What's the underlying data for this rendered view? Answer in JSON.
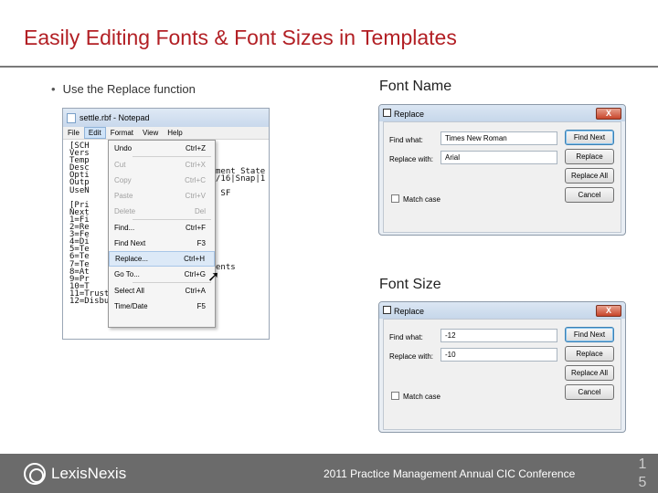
{
  "slide": {
    "title": "Easily Editing Fonts & Font Sizes in Templates",
    "bullet": "Use the Replace function",
    "label_font_name": "Font Name",
    "label_font_size": "Font Size"
  },
  "notepad": {
    "window_title": "settle.rbf - Notepad",
    "menubar": [
      "File",
      "Edit",
      "Format",
      "View",
      "Help"
    ],
    "active_menu": "Edit",
    "text_left": "[SCH\nVers\nTemp\nDesc\nOpti\nOutp\nUseN\n\n[Pri\nNext\n1=Fi\n2=Re\n3=Fe\n4=Di\n5=Te\n6=Te\n7=Te\n8=At\n9=Pr\n10=T\n11=Trust Deductions\n12=Disbursements",
    "text_right": "ment State\n/16|Snap|1\n\n SF\n\n\n\n\n\n\n\n\n\nents",
    "edit_menu": [
      {
        "label": "Undo",
        "shortcut": "Ctrl+Z",
        "disabled": false
      },
      {
        "sep": true
      },
      {
        "label": "Cut",
        "shortcut": "Ctrl+X",
        "disabled": true
      },
      {
        "label": "Copy",
        "shortcut": "Ctrl+C",
        "disabled": true
      },
      {
        "label": "Paste",
        "shortcut": "Ctrl+V",
        "disabled": true
      },
      {
        "label": "Delete",
        "shortcut": "Del",
        "disabled": true
      },
      {
        "sep": true
      },
      {
        "label": "Find...",
        "shortcut": "Ctrl+F",
        "disabled": false
      },
      {
        "label": "Find Next",
        "shortcut": "F3",
        "disabled": false
      },
      {
        "label": "Replace...",
        "shortcut": "Ctrl+H",
        "disabled": false,
        "highlighted": true
      },
      {
        "label": "Go To...",
        "shortcut": "Ctrl+G",
        "disabled": false
      },
      {
        "sep": true
      },
      {
        "label": "Select All",
        "shortcut": "Ctrl+A",
        "disabled": false
      },
      {
        "label": "Time/Date",
        "shortcut": "F5",
        "disabled": false
      }
    ]
  },
  "dialog_font_name": {
    "title": "Replace",
    "close": "X",
    "find_label": "Find what:",
    "find_value": "Times New Roman",
    "replace_label": "Replace with:",
    "replace_value": "Arial",
    "match_case": "Match case",
    "btn_find_next": "Find Next",
    "btn_replace": "Replace",
    "btn_replace_all": "Replace All",
    "btn_cancel": "Cancel"
  },
  "dialog_font_size": {
    "title": "Replace",
    "close": "X",
    "find_label": "Find what:",
    "find_value": "-12",
    "replace_label": "Replace with:",
    "replace_value": "-10",
    "match_case": "Match case",
    "btn_find_next": "Find Next",
    "btn_replace": "Replace",
    "btn_replace_all": "Replace All",
    "btn_cancel": "Cancel"
  },
  "footer": {
    "logo": "LexisNexis",
    "conference": "2011 Practice Management Annual CIC Conference",
    "page_digit_1": "1",
    "page_digit_2": "5"
  },
  "colors": {
    "title": "#b21f24",
    "footer_bg": "#6b6b6b"
  }
}
